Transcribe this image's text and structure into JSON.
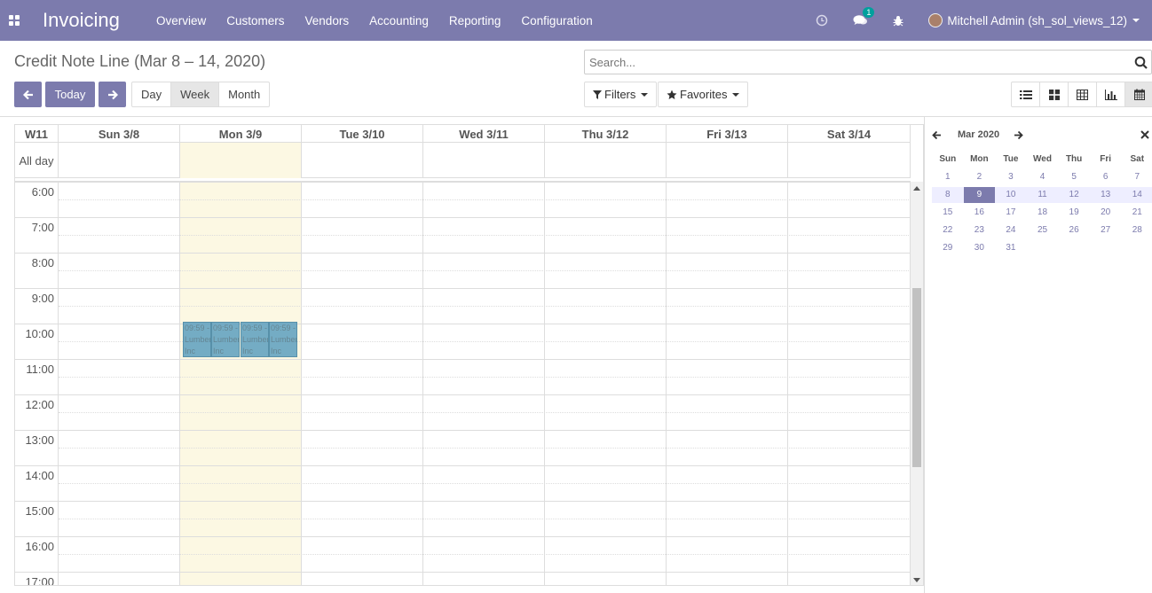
{
  "app": {
    "title": "Invoicing"
  },
  "menu": [
    "Overview",
    "Customers",
    "Vendors",
    "Accounting",
    "Reporting",
    "Configuration"
  ],
  "systray": {
    "messages_count": "1",
    "user_name": "Mitchell Admin (sh_sol_views_12)"
  },
  "control": {
    "title": "Credit Note Line (Mar 8 – 14, 2020)",
    "today_label": "Today",
    "scale_buttons": [
      "Day",
      "Week",
      "Month"
    ],
    "active_scale": "Week",
    "search_placeholder": "Search...",
    "filters_label": "Filters",
    "favorites_label": "Favorites",
    "views": [
      "list-icon",
      "kanban-icon",
      "pivot-icon",
      "graph-icon",
      "calendar-icon"
    ],
    "active_view": "calendar-icon"
  },
  "calendar": {
    "week_label": "W11",
    "days": [
      "Sun 3/8",
      "Mon 3/9",
      "Tue 3/10",
      "Wed 3/11",
      "Thu 3/12",
      "Fri 3/13",
      "Sat 3/14"
    ],
    "today_index": 1,
    "allday_label": "All day",
    "hours": [
      "6:00",
      "7:00",
      "8:00",
      "9:00",
      "10:00",
      "11:00",
      "12:00",
      "13:00",
      "14:00",
      "15:00",
      "16:00",
      "17:00"
    ],
    "events": [
      {
        "time": "09:59 -",
        "title": "Lumber Inc"
      },
      {
        "time": "09:59 -",
        "title": "Lumber Inc"
      },
      {
        "time": "09:59 -",
        "title": "Lumber Inc"
      },
      {
        "time": "09:59 -",
        "title": "Lumber Inc"
      }
    ]
  },
  "mini_calendar": {
    "month_label": "Mar 2020",
    "weekdays": [
      "Sun",
      "Mon",
      "Tue",
      "Wed",
      "Thu",
      "Fri",
      "Sat"
    ],
    "weeks": [
      [
        "1",
        "2",
        "3",
        "4",
        "5",
        "6",
        "7"
      ],
      [
        "8",
        "9",
        "10",
        "11",
        "12",
        "13",
        "14"
      ],
      [
        "15",
        "16",
        "17",
        "18",
        "19",
        "20",
        "21"
      ],
      [
        "22",
        "23",
        "24",
        "25",
        "26",
        "27",
        "28"
      ],
      [
        "29",
        "30",
        "31",
        "",
        "",
        "",
        ""
      ]
    ],
    "selected_day": "9"
  },
  "colors": {
    "brand": "#7c7bad",
    "today": "#fcf8e3",
    "event": "#5d9fbf"
  }
}
